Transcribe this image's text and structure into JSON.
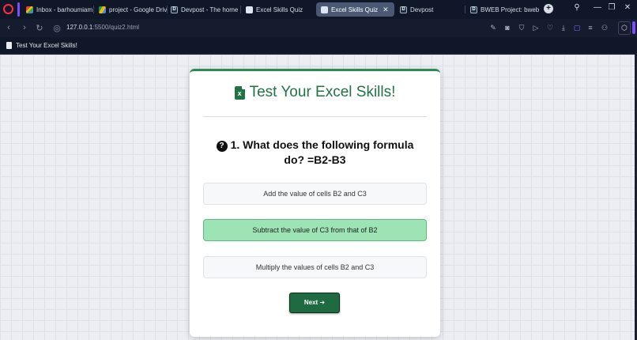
{
  "browser": {
    "tabs": [
      {
        "label": "Inbox - barhoumiamina",
        "favicon": "gmail-icon"
      },
      {
        "label": "project - Google Drive",
        "favicon": "drive-icon"
      },
      {
        "label": "Devpost - The home fo",
        "favicon": "devpost-icon"
      },
      {
        "label": "Excel Skills Quiz",
        "favicon": "globe-icon"
      },
      {
        "label": "Excel Skills Quiz",
        "favicon": "globe-icon",
        "active": true
      },
      {
        "label": "Devpost",
        "favicon": "devpost-icon"
      },
      {
        "label": "BWEB Project: bweb pro",
        "favicon": "devpost-icon"
      }
    ],
    "url_host": "127.0.0.1",
    "url_path": ":5500/quiz2.html",
    "bookmark_label": "Test Your Excel Skills!"
  },
  "quiz": {
    "title": "Test Your Excel Skills!",
    "icon_letter": "x",
    "question_number": "1.",
    "question_text": "What does the following formula do? =B2-B3",
    "options": [
      {
        "label": "Add the value of cells B2 and C3",
        "selected": false
      },
      {
        "label": "Subtract the value of C3 from that of B2",
        "selected": true
      },
      {
        "label": "Multiply the values of cells B2 and C3",
        "selected": false
      }
    ],
    "next_label": "Next ➔"
  },
  "colors": {
    "accent_green": "#217346",
    "selected_option": "#9de4b4",
    "button_green": "#1e6b41",
    "chrome_bg": "#101728"
  }
}
